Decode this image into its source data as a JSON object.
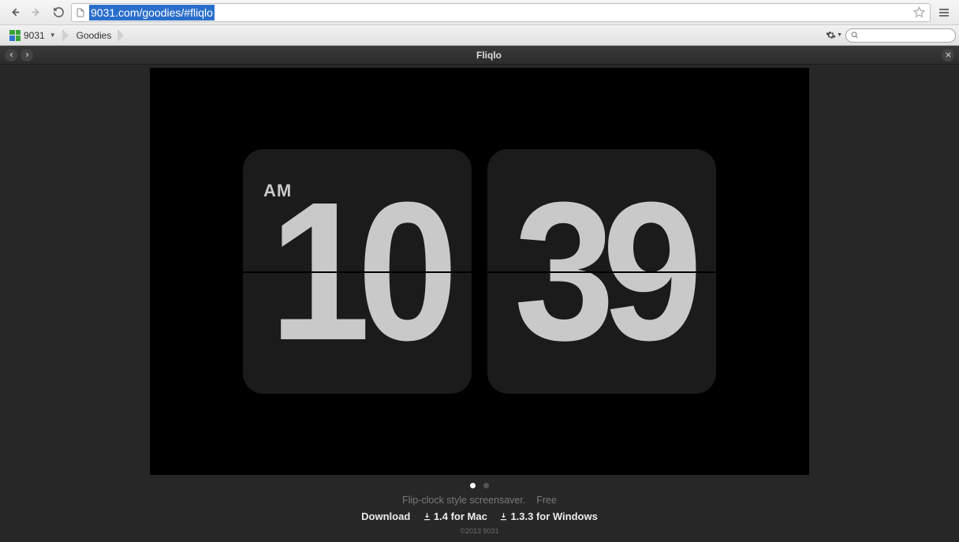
{
  "browser": {
    "url": "9031.com/goodies/#fliqlo"
  },
  "breadcrumbs": {
    "site": "9031",
    "section": "Goodies"
  },
  "overlay": {
    "title": "Fliqlo"
  },
  "clock": {
    "ampm": "AM",
    "hours": "10",
    "minutes": "39"
  },
  "pager": {
    "count": 2,
    "active": 0
  },
  "caption": {
    "desc": "Flip-clock style screensaver.",
    "price": "Free"
  },
  "downloads": {
    "label": "Download",
    "mac": "1.4 for Mac",
    "windows": "1.3.3 for Windows"
  },
  "footer": {
    "copyright": "©2013 9031"
  }
}
